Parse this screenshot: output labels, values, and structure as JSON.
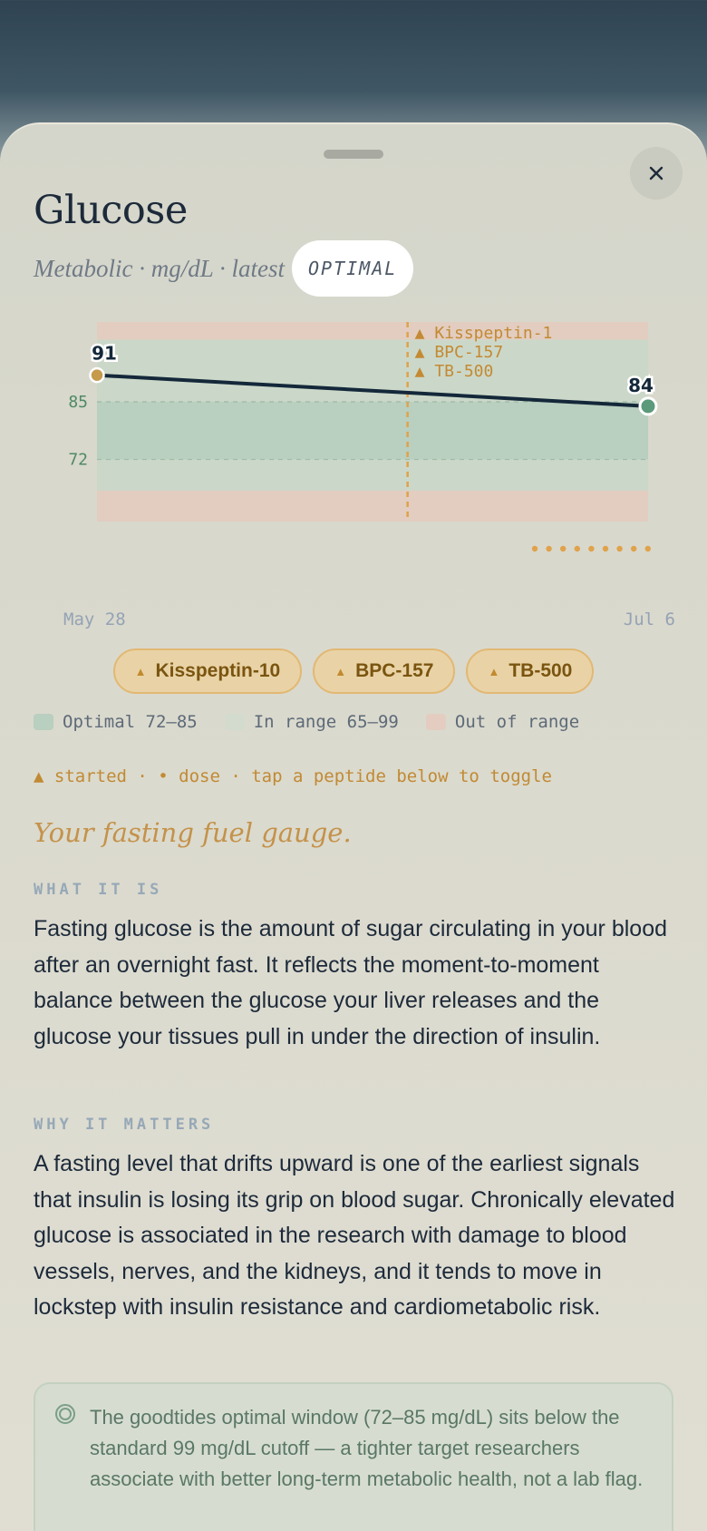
{
  "header": {
    "title": "Glucose",
    "subtitle": "Metabolic · mg/dL · latest",
    "status": "OPTIMAL",
    "close_icon": "close-icon"
  },
  "chart_data": {
    "type": "line",
    "x": [
      "May 28",
      "Jul 6"
    ],
    "series": [
      {
        "values": [
          91,
          84
        ]
      }
    ],
    "point_labels": [
      "91",
      "84"
    ],
    "y_ticks": [
      85,
      72
    ],
    "ylim": [
      58,
      103
    ],
    "bands": [
      {
        "label": "Optimal 72–85",
        "from": 72,
        "to": 85,
        "color": "#b9cfbf"
      },
      {
        "label": "In range 65–99",
        "from": 65,
        "to": 99,
        "color": "#cbd8c9"
      },
      {
        "label": "Out of range",
        "color": "#e2cdc0"
      }
    ],
    "marker_fraction": 0.5636,
    "marker_labels": [
      "▲ Kisspeptin-1",
      "▲ BPC-157",
      "▲ TB-500"
    ],
    "dose_dot_count": 9,
    "colors": {
      "line": "#14283a",
      "start": "#c59a4a",
      "end": "#5b9a7a",
      "marker": "#e0a24a"
    }
  },
  "dates": {
    "start": "May 28",
    "end": "Jul 6"
  },
  "peptides": [
    {
      "label": "Kisspeptin-10",
      "icon": "▲"
    },
    {
      "label": "BPC-157",
      "icon": "▲"
    },
    {
      "label": "TB-500",
      "icon": "▲"
    }
  ],
  "legend": [
    {
      "label": "Optimal 72–85",
      "color": "#b9cfbf"
    },
    {
      "label": "In range 65–99",
      "color": "#d3dbcf"
    },
    {
      "label": "Out of range",
      "color": "#e4cdc0"
    }
  ],
  "hint": "▲ started · • dose · tap a peptide below to toggle",
  "tagline": "Your fasting fuel gauge.",
  "sections": [
    {
      "heading": "WHAT IT IS",
      "body": "Fasting glucose is the amount of sugar circulating in your blood after an overnight fast. It reflects the moment-to-moment balance between the glucose your liver releases and the glucose your tissues pull in under the direction of insulin."
    },
    {
      "heading": "WHY IT MATTERS",
      "body": "A fasting level that drifts upward is one of the earliest signals that insulin is losing its grip on blood sugar. Chronically elevated glucose is associated in the research with damage to blood vessels, nerves, and the kidneys, and it tends to move in lockstep with insulin resistance and cardiometabolic risk."
    }
  ],
  "callout": {
    "icon": "target-icon",
    "text": "The goodtides optimal window (72–85 mg/dL) sits below the standard 99 mg/dL cutoff — a tighter target researchers associate with better long-term metabolic health, not a lab flag."
  }
}
